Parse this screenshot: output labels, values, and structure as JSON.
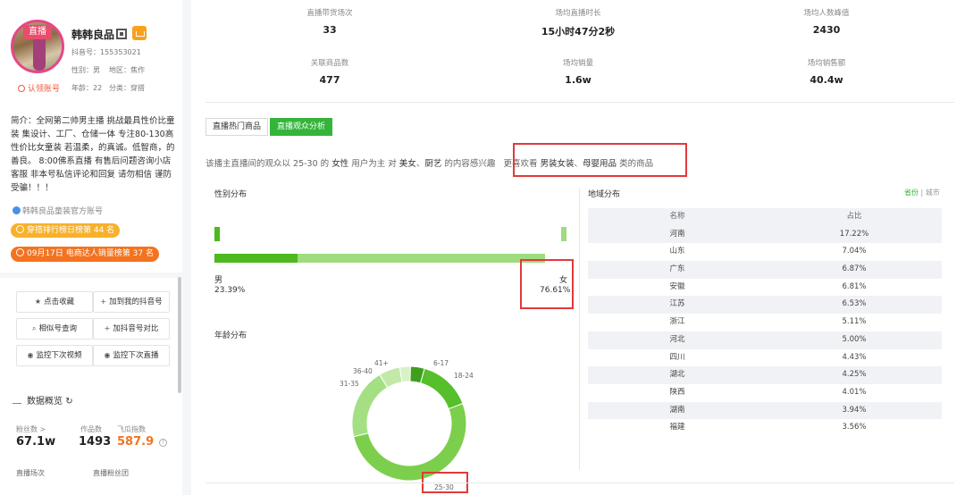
{
  "profile": {
    "live_tag": "直播",
    "name": "韩韩良品",
    "douyin_id": "抖音号：155353021",
    "gender": "性别：男",
    "region": "地区：焦作",
    "claim": "认领账号",
    "age": "年龄：22",
    "category": "分类：穿搭",
    "bio": "简介：全网第二帅男主播 挑战最具性价比童装 集设计、工厂、仓储一体 专注80-130高性价比女童装 若温柔，的真诚。低智商，的善良。 8:00佛系直播 有售后问题咨询小店客服 非本号私信评论和回复 请勿相信 谨防受骗！！！",
    "official": "韩韩良品童装官方账号",
    "badge_rank": "穿搭排行榜日榜第 44 名",
    "badge_sales": "09月17日 电商达人销量榜第 37 名"
  },
  "actions": {
    "favorite": "点击收藏",
    "add_mine": "加到我的抖音号",
    "similar": "相似号查询",
    "compare": "加抖音号对比",
    "monitor_video": "监控下次视频",
    "monitor_live": "监控下次直播"
  },
  "overview": {
    "title": "数据概览",
    "fans_label": "粉丝数 >",
    "fans_value": "67.1w",
    "works_label": "作品数",
    "works_value": "1493",
    "index_label": "飞瓜指数",
    "index_value": "587.9",
    "help": "?",
    "live_count_label": "直播场次",
    "live_fans_label": "直播粉丝团"
  },
  "kpis": [
    {
      "label": "直播带货场次",
      "value": "33"
    },
    {
      "label": "场均直播时长",
      "value": "15小时47分2秒"
    },
    {
      "label": "场均人数峰值",
      "value": "2430"
    },
    {
      "label": "关联商品数",
      "value": "477"
    },
    {
      "label": "场均销量",
      "value": "1.6w"
    },
    {
      "label": "场均销售额",
      "value": "40.4w"
    }
  ],
  "tabs": [
    {
      "label": "直播热门商品"
    },
    {
      "label": "直播观众分析"
    }
  ],
  "summary": {
    "prefix": "该播主直播间的观众以 25-30 的",
    "gender": "女性",
    "mid1": "用户为主 对",
    "interest1": "美女",
    "sep": "、",
    "interest2": "厨艺",
    "mid2": "的内容感兴趣",
    "pref_prefix": "更喜欢看",
    "pref1": "男装女装",
    "pref2": "母婴用品",
    "pref_suffix": "类的商品"
  },
  "gender": {
    "title": "性别分布",
    "male_label": "男",
    "male_value": "23.39%",
    "female_label": "女",
    "female_value": "76.61%",
    "male_color": "#4eb81f",
    "female_color": "#9fdb7f"
  },
  "age": {
    "title": "年龄分布",
    "labels": [
      "6-17",
      "18-24",
      "25-30",
      "31-35",
      "36-40",
      "41+"
    ]
  },
  "chart_data": {
    "type": "pie",
    "title": "年龄分布",
    "categories": [
      "6-17",
      "18-24",
      "25-30",
      "31-35",
      "36-40",
      "41+"
    ],
    "values": [
      4,
      15,
      52,
      20,
      6,
      3
    ],
    "colors": [
      "#3f9f1d",
      "#56bf2c",
      "#7ccf4c",
      "#a5df84",
      "#c3e9a9",
      "#d8f1c6"
    ]
  },
  "regions": {
    "title": "地域分布",
    "toggle_province": "省份",
    "toggle_sep": " | ",
    "toggle_city": "城市",
    "header_name": "名称",
    "header_share": "占比",
    "rows": [
      {
        "name": "河南",
        "share": "17.22%"
      },
      {
        "name": "山东",
        "share": "7.04%"
      },
      {
        "name": "广东",
        "share": "6.87%"
      },
      {
        "name": "安徽",
        "share": "6.81%"
      },
      {
        "name": "江苏",
        "share": "6.53%"
      },
      {
        "name": "浙江",
        "share": "5.11%"
      },
      {
        "name": "河北",
        "share": "5.00%"
      },
      {
        "name": "四川",
        "share": "4.43%"
      },
      {
        "name": "湖北",
        "share": "4.25%"
      },
      {
        "name": "陕西",
        "share": "4.01%"
      },
      {
        "name": "湖南",
        "share": "3.94%"
      },
      {
        "name": "福建",
        "share": "3.56%"
      }
    ]
  }
}
